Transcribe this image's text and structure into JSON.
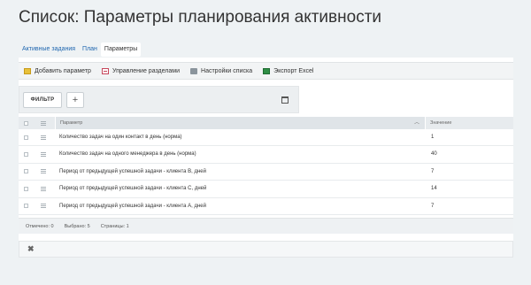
{
  "page_title": "Список: Параметры планирования активности",
  "tabs": [
    {
      "label": "Активные задания"
    },
    {
      "label": "План"
    },
    {
      "label": "Параметры"
    }
  ],
  "toolbar": {
    "add_label": "Добавить параметр",
    "sections_label": "Управление разделами",
    "settings_label": "Настройки списка",
    "excel_label": "Экспорт Excel"
  },
  "filter": {
    "filter_label": "ФИЛЬТР",
    "add_label": "+"
  },
  "table": {
    "headers": {
      "param": "Параметр",
      "value": "Значение"
    },
    "sort_icon": "chevron-up",
    "rows": [
      {
        "param": "Количество задач на один контакт в день (норма)",
        "value": "1"
      },
      {
        "param": "Количество задач на одного менеджера в день (норма)",
        "value": "40"
      },
      {
        "param": "Период от предыдущей успешной задачи - клиента B, дней",
        "value": "7"
      },
      {
        "param": "Период от предыдущей успешной задачи - клиента C, дней",
        "value": "14"
      },
      {
        "param": "Период от предыдущей успешной задачи - клиента A, дней",
        "value": "7"
      }
    ]
  },
  "footer": {
    "marked": "Отмечено: 0",
    "selected": "Выбрано: 5",
    "pages": "Страницы: 1"
  },
  "action_bar": {
    "close_glyph": "✖"
  },
  "colors": {
    "link": "#2067b0",
    "background": "#eef2f4"
  }
}
